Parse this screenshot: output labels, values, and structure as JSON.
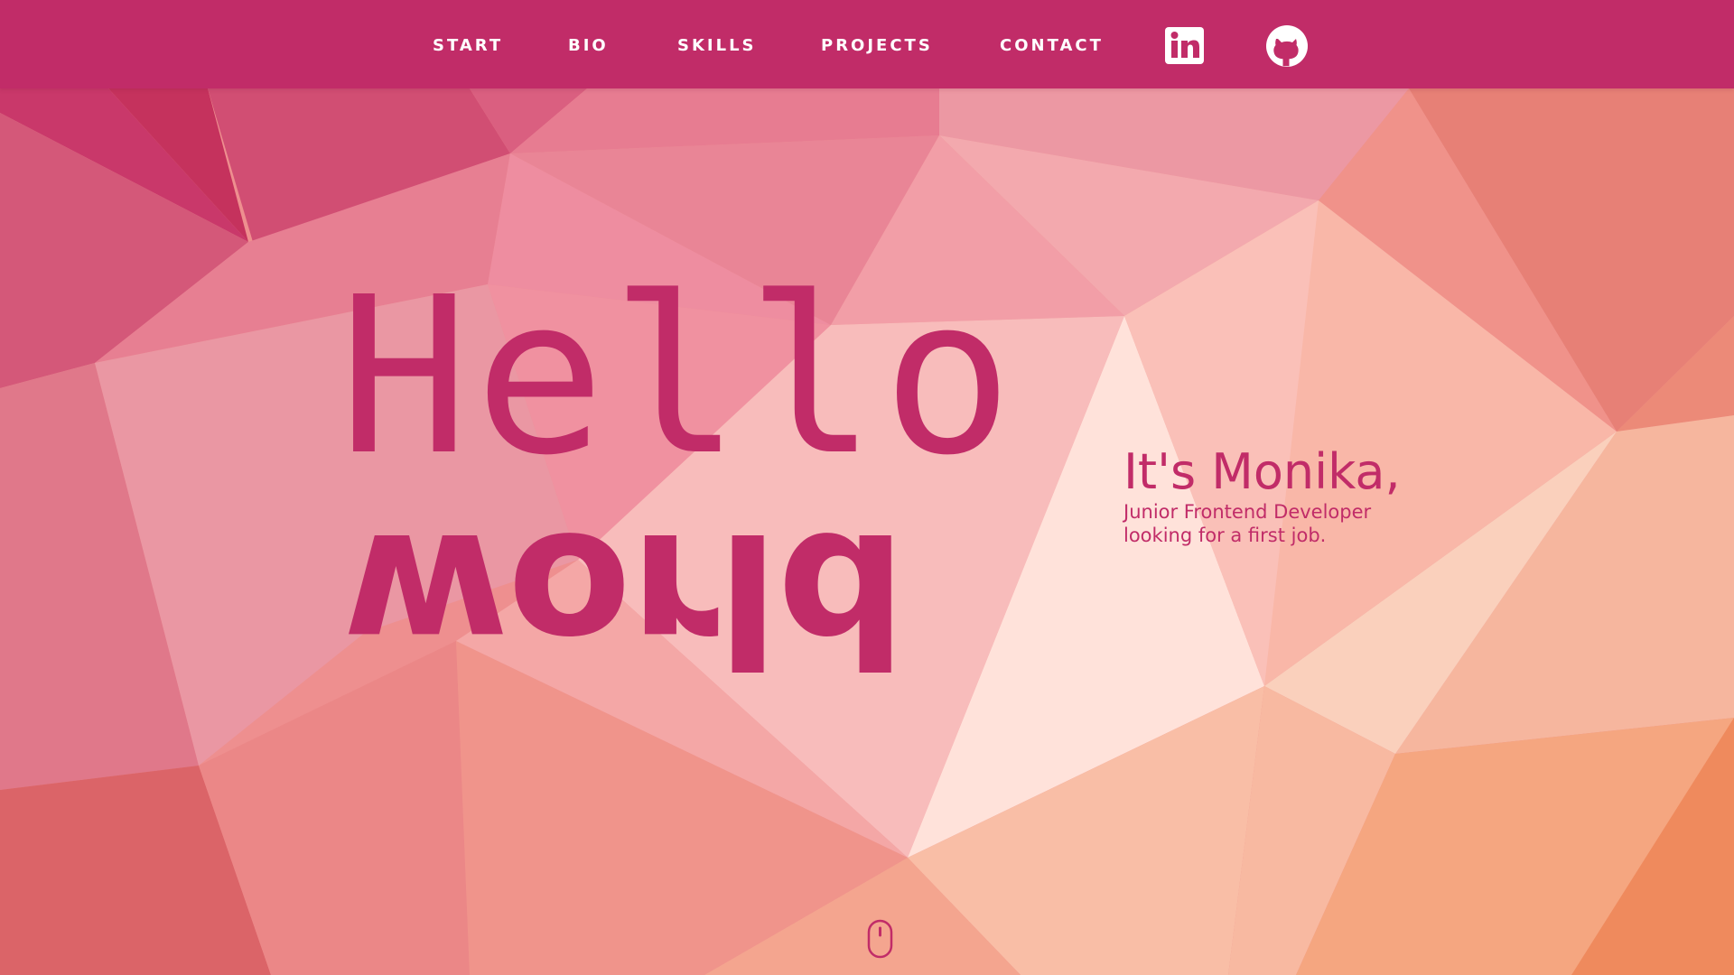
{
  "nav": {
    "items": [
      {
        "label": "START"
      },
      {
        "label": "BIO"
      },
      {
        "label": "SKILLS"
      },
      {
        "label": "PROJECTS"
      },
      {
        "label": "CONTACT"
      }
    ],
    "social": [
      {
        "icon": "linkedin-icon"
      },
      {
        "icon": "github-icon"
      }
    ]
  },
  "hero": {
    "hello": "Hello",
    "world": "world",
    "name": "It's Monika,",
    "tagline_line1": "Junior Frontend Developer",
    "tagline_line2": "looking for a first job."
  },
  "scroll": {
    "icon": "mouse-scroll-icon"
  },
  "colors": {
    "brand": "#c12c68",
    "nav_text": "#ffffff",
    "background_start": "#d2526f",
    "background_highlight": "#ffe2da",
    "background_end": "#f28a5c"
  }
}
